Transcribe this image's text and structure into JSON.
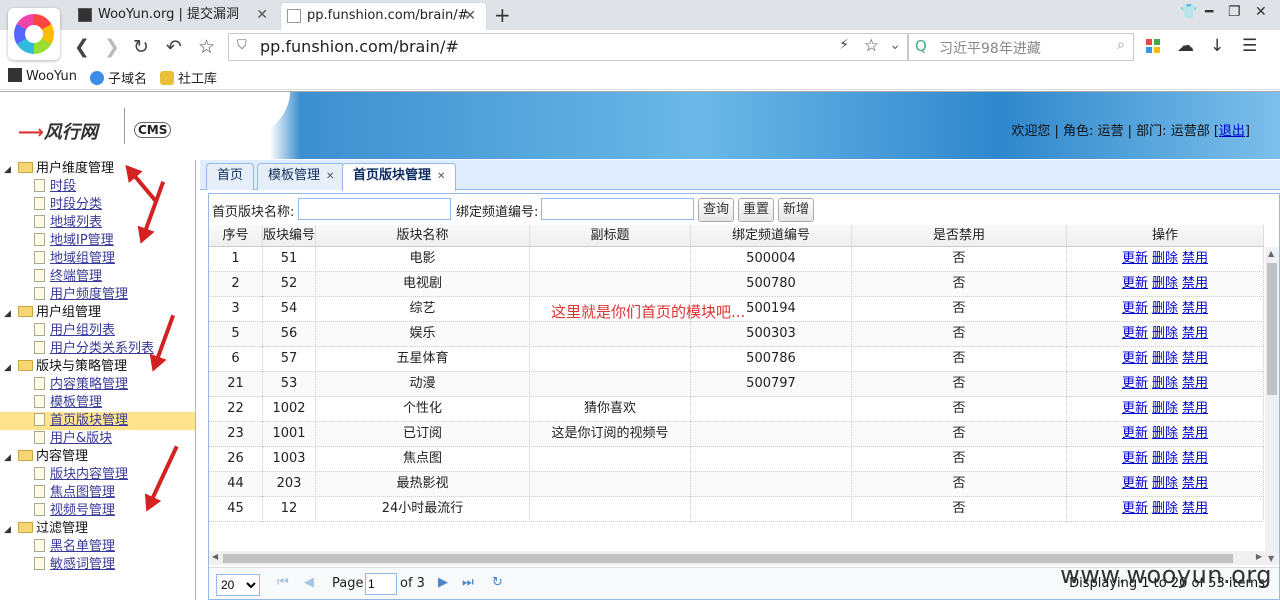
{
  "browser": {
    "tabs": [
      {
        "title": "WooYun.org | 提交漏洞"
      },
      {
        "title": "pp.funshion.com/brain/#"
      }
    ],
    "url": "pp.funshion.com/brain/#",
    "search_placeholder": "习近平98年进藏",
    "bookmarks": [
      "WooYun",
      "子域名",
      "社工库"
    ]
  },
  "header": {
    "brand": "风行网",
    "cms": "CMS",
    "welcome_text": "欢迎您 | 角色: 运营 | 部门: 运营部 [",
    "logout": "退出",
    "welcome_end": "]"
  },
  "sidebar": {
    "groups": [
      {
        "label": "用户维度管理",
        "items": [
          "时段",
          "时段分类",
          "地域列表",
          "地域IP管理",
          "地域组管理",
          "终端管理",
          "用户频度管理"
        ]
      },
      {
        "label": "用户组管理",
        "items": [
          "用户组列表",
          "用户分类关系列表"
        ]
      },
      {
        "label": "版块与策略管理",
        "items": [
          "内容策略管理",
          "模板管理",
          "首页版块管理",
          "用户&版块"
        ]
      },
      {
        "label": "内容管理",
        "items": [
          "版块内容管理",
          "焦点图管理",
          "视频号管理"
        ]
      },
      {
        "label": "过滤管理",
        "items": [
          "黑名单管理",
          "敏感词管理"
        ]
      }
    ],
    "selected": "首页版块管理"
  },
  "content_tabs": [
    {
      "label": "首页"
    },
    {
      "label": "模板管理"
    },
    {
      "label": "首页版块管理"
    }
  ],
  "toolbar": {
    "name_label": "首页版块名称:",
    "channel_label": "绑定频道编号:",
    "query_btn": "查询",
    "reset_btn": "重置",
    "add_btn": "新增"
  },
  "grid": {
    "columns": [
      "序号",
      "版块编号",
      "版块名称",
      "副标题",
      "绑定频道编号",
      "是否禁用",
      "操作"
    ],
    "rows": [
      [
        "1",
        "51",
        "电影",
        "",
        "500004",
        "否"
      ],
      [
        "2",
        "52",
        "电视剧",
        "",
        "500780",
        "否"
      ],
      [
        "3",
        "54",
        "综艺",
        "",
        "500194",
        "否"
      ],
      [
        "5",
        "56",
        "娱乐",
        "",
        "500303",
        "否"
      ],
      [
        "6",
        "57",
        "五星体育",
        "",
        "500786",
        "否"
      ],
      [
        "21",
        "53",
        "动漫",
        "",
        "500797",
        "否"
      ],
      [
        "22",
        "1002",
        "个性化",
        "猜你喜欢",
        "",
        "否"
      ],
      [
        "23",
        "1001",
        "已订阅",
        "这是你订阅的视频号",
        "",
        "否"
      ],
      [
        "26",
        "1003",
        "焦点图",
        "",
        "",
        "否"
      ],
      [
        "44",
        "203",
        "最热影视",
        "",
        "",
        "否"
      ],
      [
        "45",
        "12",
        "24小时最流行",
        "",
        "",
        "否"
      ]
    ],
    "actions": [
      "更新",
      "删除",
      "禁用"
    ]
  },
  "annotation": "这里就是你们首页的模块吧...",
  "pager": {
    "page_size": "20",
    "page_label": "Page",
    "page_value": "1",
    "of_text": "of 3",
    "display": "Displaying 1 to 20 of 53 items"
  },
  "watermark": "www.wooyun.org"
}
